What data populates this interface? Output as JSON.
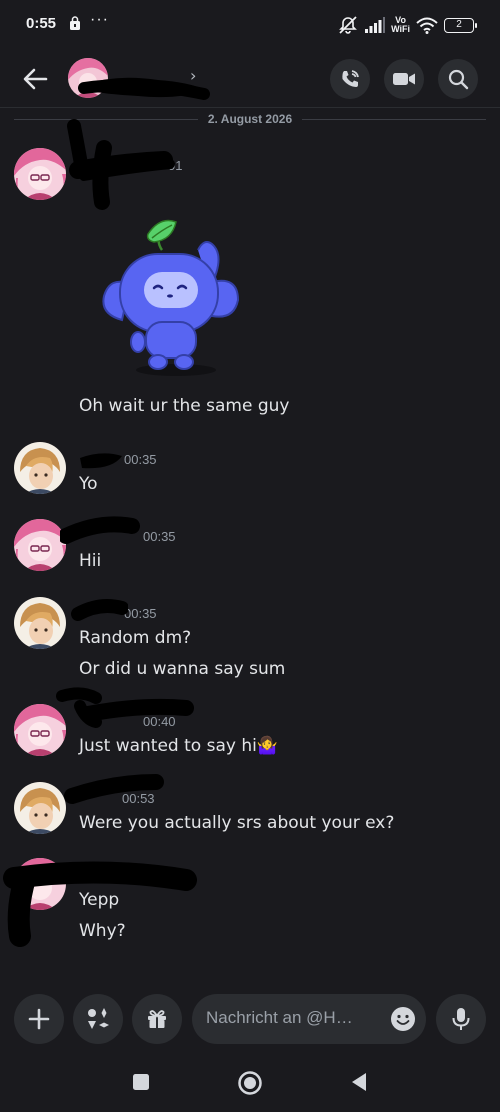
{
  "status_bar": {
    "time": "0:55",
    "dots": "···",
    "network_label_top": "Vo",
    "network_label_bottom": "WiFi",
    "battery": "2"
  },
  "header": {
    "icons": [
      "back-arrow-icon",
      "voice-call-icon",
      "video-call-icon",
      "search-icon"
    ]
  },
  "date_divider": "2. August 2026",
  "messages": [
    {
      "time_fragment": "01",
      "text": "Oh wait ur the same guy",
      "sticker": "Wumpus waving"
    },
    {
      "time_fragment": "00:35",
      "text": "Yo"
    },
    {
      "time_fragment": "00:35",
      "text": "Hii"
    },
    {
      "time_fragment": "00:35",
      "lines": [
        "Random dm?",
        "Or did u wanna say sum"
      ]
    },
    {
      "time_fragment": "00:40",
      "text": "Just wanted to say hi🤷‍♀️"
    },
    {
      "time_fragment": "00:53",
      "text": "Were you actually srs about your ex?"
    },
    {
      "lines": [
        "Yepp",
        "Why?"
      ]
    }
  ],
  "composer": {
    "placeholder": "Nachricht an @H…",
    "icons": [
      "plus-icon",
      "apps-icon",
      "gift-icon",
      "emoji-icon",
      "microphone-icon"
    ]
  },
  "nav": {
    "icons": [
      "recent-apps-icon",
      "home-icon",
      "back-icon"
    ]
  },
  "colors": {
    "background": "#1a1a1e",
    "button_bg": "#2b2d31",
    "text": "#e3e5e8",
    "muted": "#949ba4",
    "wumpus": "#5865f2",
    "leaf": "#57d16a"
  }
}
